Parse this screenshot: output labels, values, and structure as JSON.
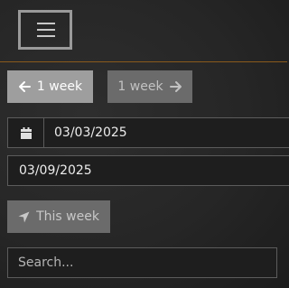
{
  "navbar": {
    "menu_toggle_icon": "hamburger-menu-icon",
    "border_color": "#8a5a1c"
  },
  "week_nav": {
    "prev_label": "1 week",
    "prev_icon": "arrow-left-icon",
    "next_label": "1 week",
    "next_icon": "arrow-right-icon"
  },
  "date_range": {
    "start_icon": "calendar-icon",
    "start_value": "03/03/2025",
    "end_value": "03/09/2025"
  },
  "this_week": {
    "label": "This week",
    "icon": "location-arrow-icon"
  },
  "search": {
    "placeholder": "Search..."
  }
}
